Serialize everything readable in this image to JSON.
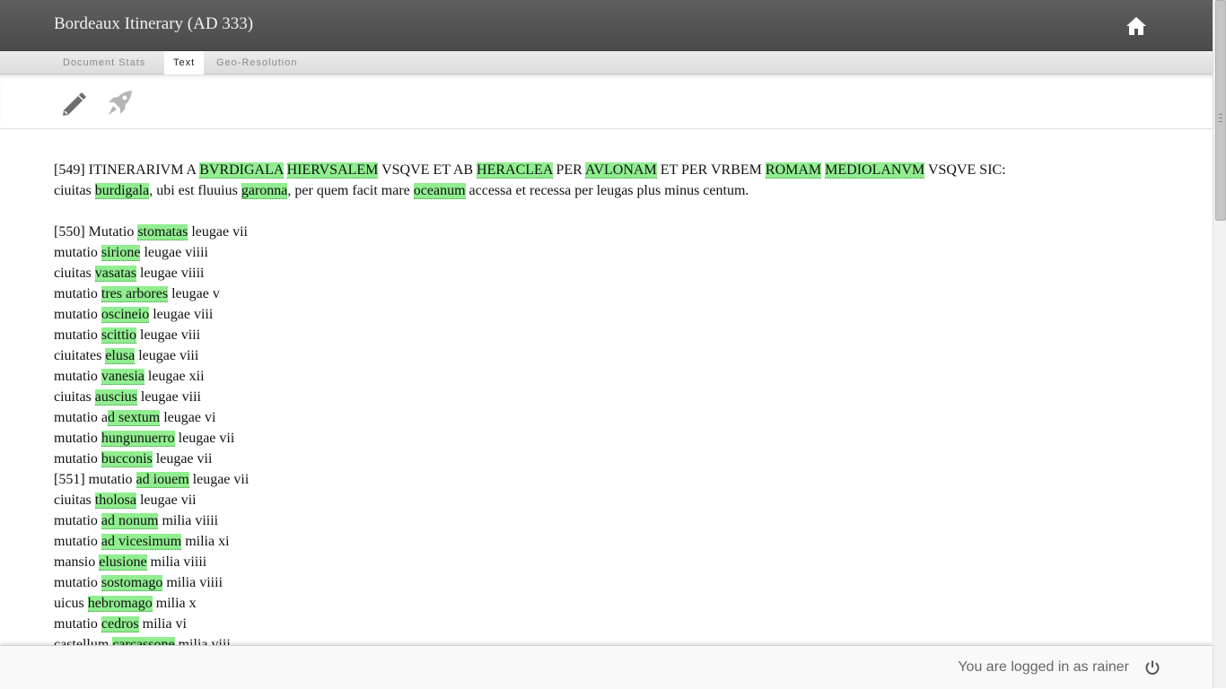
{
  "header": {
    "title": "Bordeaux Itinerary (AD 333)",
    "home_icon": "home-icon"
  },
  "tabs": [
    {
      "label": "Document Stats",
      "active": false
    },
    {
      "label": "Text",
      "active": true
    },
    {
      "label": "Geo-Resolution",
      "active": false
    }
  ],
  "toolbar": {
    "tools": [
      "pencil-icon",
      "rocket-icon"
    ]
  },
  "highlight_color": "#90ee90",
  "text": {
    "lines": [
      [
        {
          "t": "[549] ITINERARIVM A "
        },
        {
          "t": "BVRDIGALA",
          "p": 1
        },
        {
          "t": " "
        },
        {
          "t": "HIERVSALEM",
          "p": 1
        },
        {
          "t": " VSQVE ET AB "
        },
        {
          "t": "HERACLEA",
          "p": 1
        },
        {
          "t": " PER "
        },
        {
          "t": "AVLONAM",
          "p": 1
        },
        {
          "t": " ET PER VRBEM "
        },
        {
          "t": "ROMAM",
          "p": 1
        },
        {
          "t": " "
        },
        {
          "t": "MEDIOLANVM",
          "p": 1
        },
        {
          "t": " VSQVE SIC:"
        }
      ],
      [
        {
          "t": "ciuitas "
        },
        {
          "t": "burdigala",
          "p": 1
        },
        {
          "t": ", ubi est fluuius "
        },
        {
          "t": "garonna",
          "p": 1
        },
        {
          "t": ", per quem facit mare "
        },
        {
          "t": "oceanum",
          "p": 1
        },
        {
          "t": " accessa et recessa per leugas plus minus centum."
        }
      ],
      [],
      [
        {
          "t": "[550] Mutatio "
        },
        {
          "t": "stomatas",
          "p": 1
        },
        {
          "t": " leugae vii"
        }
      ],
      [
        {
          "t": "mutatio "
        },
        {
          "t": "sirione",
          "p": 1
        },
        {
          "t": " leugae viiii"
        }
      ],
      [
        {
          "t": "ciuitas "
        },
        {
          "t": "vasatas",
          "p": 1
        },
        {
          "t": " leugae viiii"
        }
      ],
      [
        {
          "t": "mutatio "
        },
        {
          "t": "tres arbores",
          "p": 1
        },
        {
          "t": " leugae v"
        }
      ],
      [
        {
          "t": "mutatio "
        },
        {
          "t": "oscineio",
          "p": 1
        },
        {
          "t": " leugae viii"
        }
      ],
      [
        {
          "t": "mutatio "
        },
        {
          "t": "scittio",
          "p": 1
        },
        {
          "t": " leugae viii"
        }
      ],
      [
        {
          "t": "ciuitates "
        },
        {
          "t": "elusa",
          "p": 1
        },
        {
          "t": " leugae viii"
        }
      ],
      [
        {
          "t": "mutatio "
        },
        {
          "t": "vanesia",
          "p": 1
        },
        {
          "t": " leugae xii"
        }
      ],
      [
        {
          "t": "ciuitas "
        },
        {
          "t": "auscius",
          "p": 1
        },
        {
          "t": " leugae viii"
        }
      ],
      [
        {
          "t": "mutatio a"
        },
        {
          "t": "d sextum",
          "p": 1
        },
        {
          "t": " leugae vi"
        }
      ],
      [
        {
          "t": "mutatio "
        },
        {
          "t": "hungunuerro",
          "p": 1
        },
        {
          "t": " leugae vii"
        }
      ],
      [
        {
          "t": "mutatio "
        },
        {
          "t": "bucconis",
          "p": 1
        },
        {
          "t": " leugae vii"
        }
      ],
      [
        {
          "t": "[551] mutatio "
        },
        {
          "t": "ad iouem",
          "p": 1
        },
        {
          "t": " leugae vii"
        }
      ],
      [
        {
          "t": "ciuitas "
        },
        {
          "t": "tholosa",
          "p": 1
        },
        {
          "t": " leugae vii"
        }
      ],
      [
        {
          "t": "mutatio "
        },
        {
          "t": "ad nonum",
          "p": 1
        },
        {
          "t": " milia viiii"
        }
      ],
      [
        {
          "t": "mutatio "
        },
        {
          "t": "ad vicesimum",
          "p": 1
        },
        {
          "t": " milia xi"
        }
      ],
      [
        {
          "t": "mansio "
        },
        {
          "t": "elusione",
          "p": 1
        },
        {
          "t": " milia viiii"
        }
      ],
      [
        {
          "t": "mutatio "
        },
        {
          "t": "sostomago",
          "p": 1
        },
        {
          "t": " milia viiii"
        }
      ],
      [
        {
          "t": "uicus "
        },
        {
          "t": "hebromago",
          "p": 1
        },
        {
          "t": " milia x"
        }
      ],
      [
        {
          "t": "mutatio "
        },
        {
          "t": "cedros",
          "p": 1
        },
        {
          "t": " milia vi"
        }
      ],
      [
        {
          "t": "castellum "
        },
        {
          "t": "carcassone",
          "p": 1
        },
        {
          "t": " milia viii"
        }
      ]
    ]
  },
  "footer": {
    "login_text": "You are logged in as rainer",
    "logout_icon": "power-icon"
  }
}
